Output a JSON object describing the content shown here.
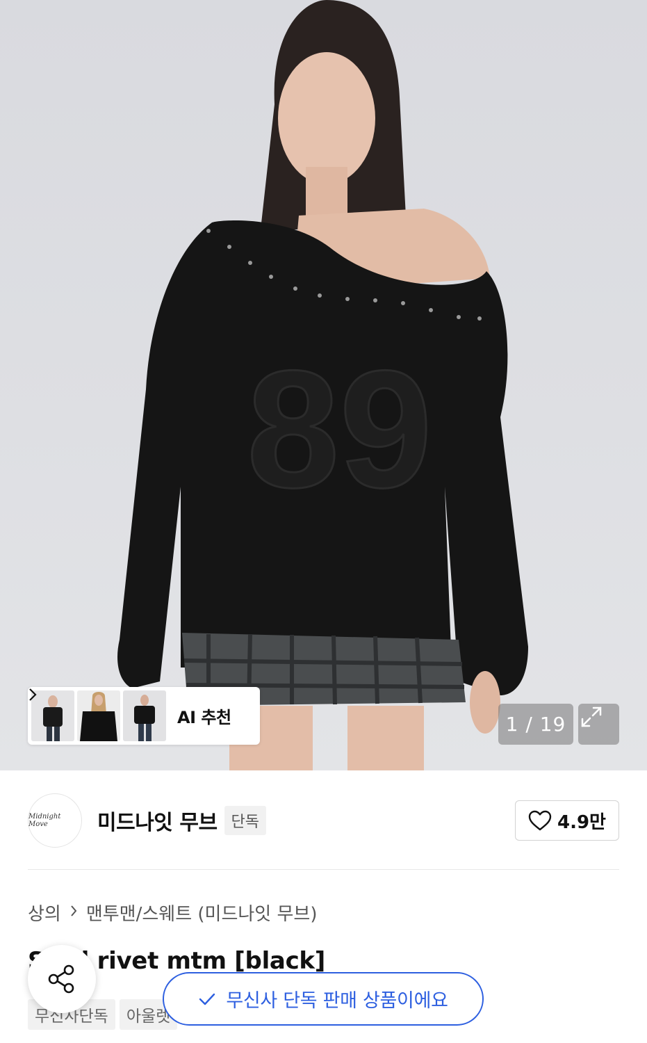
{
  "gallery": {
    "counter": "1 / 19",
    "ai_recommend_label": "AI 추천",
    "thumbnails": [
      {
        "icon": "model-thumbnail-1"
      },
      {
        "icon": "model-thumbnail-2"
      },
      {
        "icon": "model-thumbnail-3"
      }
    ]
  },
  "brand": {
    "logo_text": "Midnight Move",
    "name": "미드나잇 무브",
    "tag": "단독",
    "like_count": "4.9만"
  },
  "breadcrumb": {
    "category": "상의",
    "subcategory": "맨투맨/스웨트 (미드나잇 무브)"
  },
  "product": {
    "title": "Stud rivet mtm [black]",
    "tags": [
      "무신사단독",
      "아울렛"
    ]
  },
  "overlay": {
    "exclusive_message": "무신사 단독 판매 상품이에요"
  },
  "colors": {
    "accent_blue": "#2d5fe0",
    "sweater": "#151515"
  }
}
